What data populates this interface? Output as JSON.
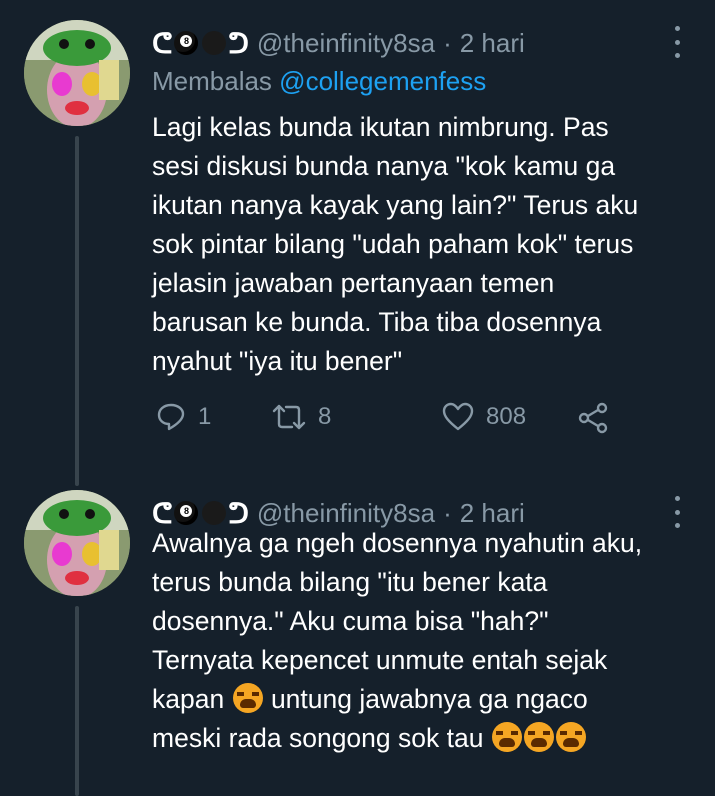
{
  "tweets": [
    {
      "handle": "@theinfinity8sa",
      "time": "2 hari",
      "reply_prefix": "Membalas",
      "reply_handle": "@collegemenfess",
      "text_before": "Lagi kelas bunda ikutan nimbrung. Pas\nsesi diskusi bunda nanya \"kok kamu ga\nikutan nanya kayak yang lain?\" Terus aku\nsok pintar bilang \"udah paham kok\" terus\njelasin jawaban pertanyaan temen\nbarusan ke bunda. Tiba tiba dosennya\nnyahut \"iya itu bener\"",
      "reply_count": "1",
      "retweet_count": "8",
      "like_count": "808"
    },
    {
      "handle": "@theinfinity8sa",
      "time": "2 hari",
      "text_part1": "Awalnya ga ngeh dosennya nyahutin aku,\nterus bunda bilang \"itu bener kata\ndosennya.\" Aku cuma bisa \"hah?\"\nTernyata kepencet unmute entah sejak\nkapan ",
      "text_part2": " untung jawabnya ga ngaco\nmeski rada songong sok tau "
    }
  ],
  "separator": "·",
  "icons": {
    "name_emoji": [
      "left-paren",
      "eight-ball-icon",
      "black-ball-icon",
      "right-paren"
    ],
    "reply": "reply-icon",
    "retweet": "retweet-icon",
    "like": "heart-icon",
    "share": "share-icon",
    "inline_emoji": "tired-face-emoji"
  },
  "colors": {
    "background": "#15202b",
    "text": "#ffffff",
    "secondary": "#8899a6",
    "link": "#1da1f2",
    "thread_line": "#38444d"
  }
}
